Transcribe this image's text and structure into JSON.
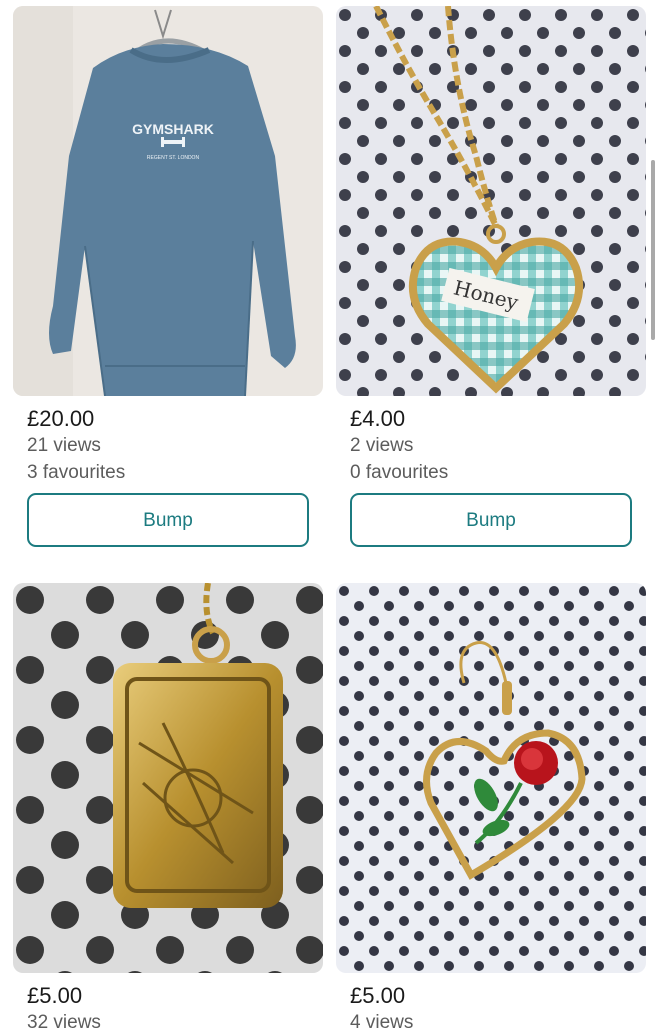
{
  "items": [
    {
      "price": "£20.00",
      "views": "21 views",
      "favourites": "3 favourites",
      "bump_label": "Bump",
      "photo_text": [
        "GYMSHARK",
        "REGENT ST. LONDON"
      ]
    },
    {
      "price": "£4.00",
      "views": "2 views",
      "favourites": "0 favourites",
      "bump_label": "Bump",
      "photo_text": [
        "Honey"
      ]
    },
    {
      "price": "£5.00",
      "views": "32 views"
    },
    {
      "price": "£5.00",
      "views": "4 views"
    }
  ],
  "colors": {
    "accent": "#1c7b80",
    "price": "#1a1a1a",
    "secondary_text": "#5c5c5c",
    "sweater": "#5b7f9c"
  }
}
